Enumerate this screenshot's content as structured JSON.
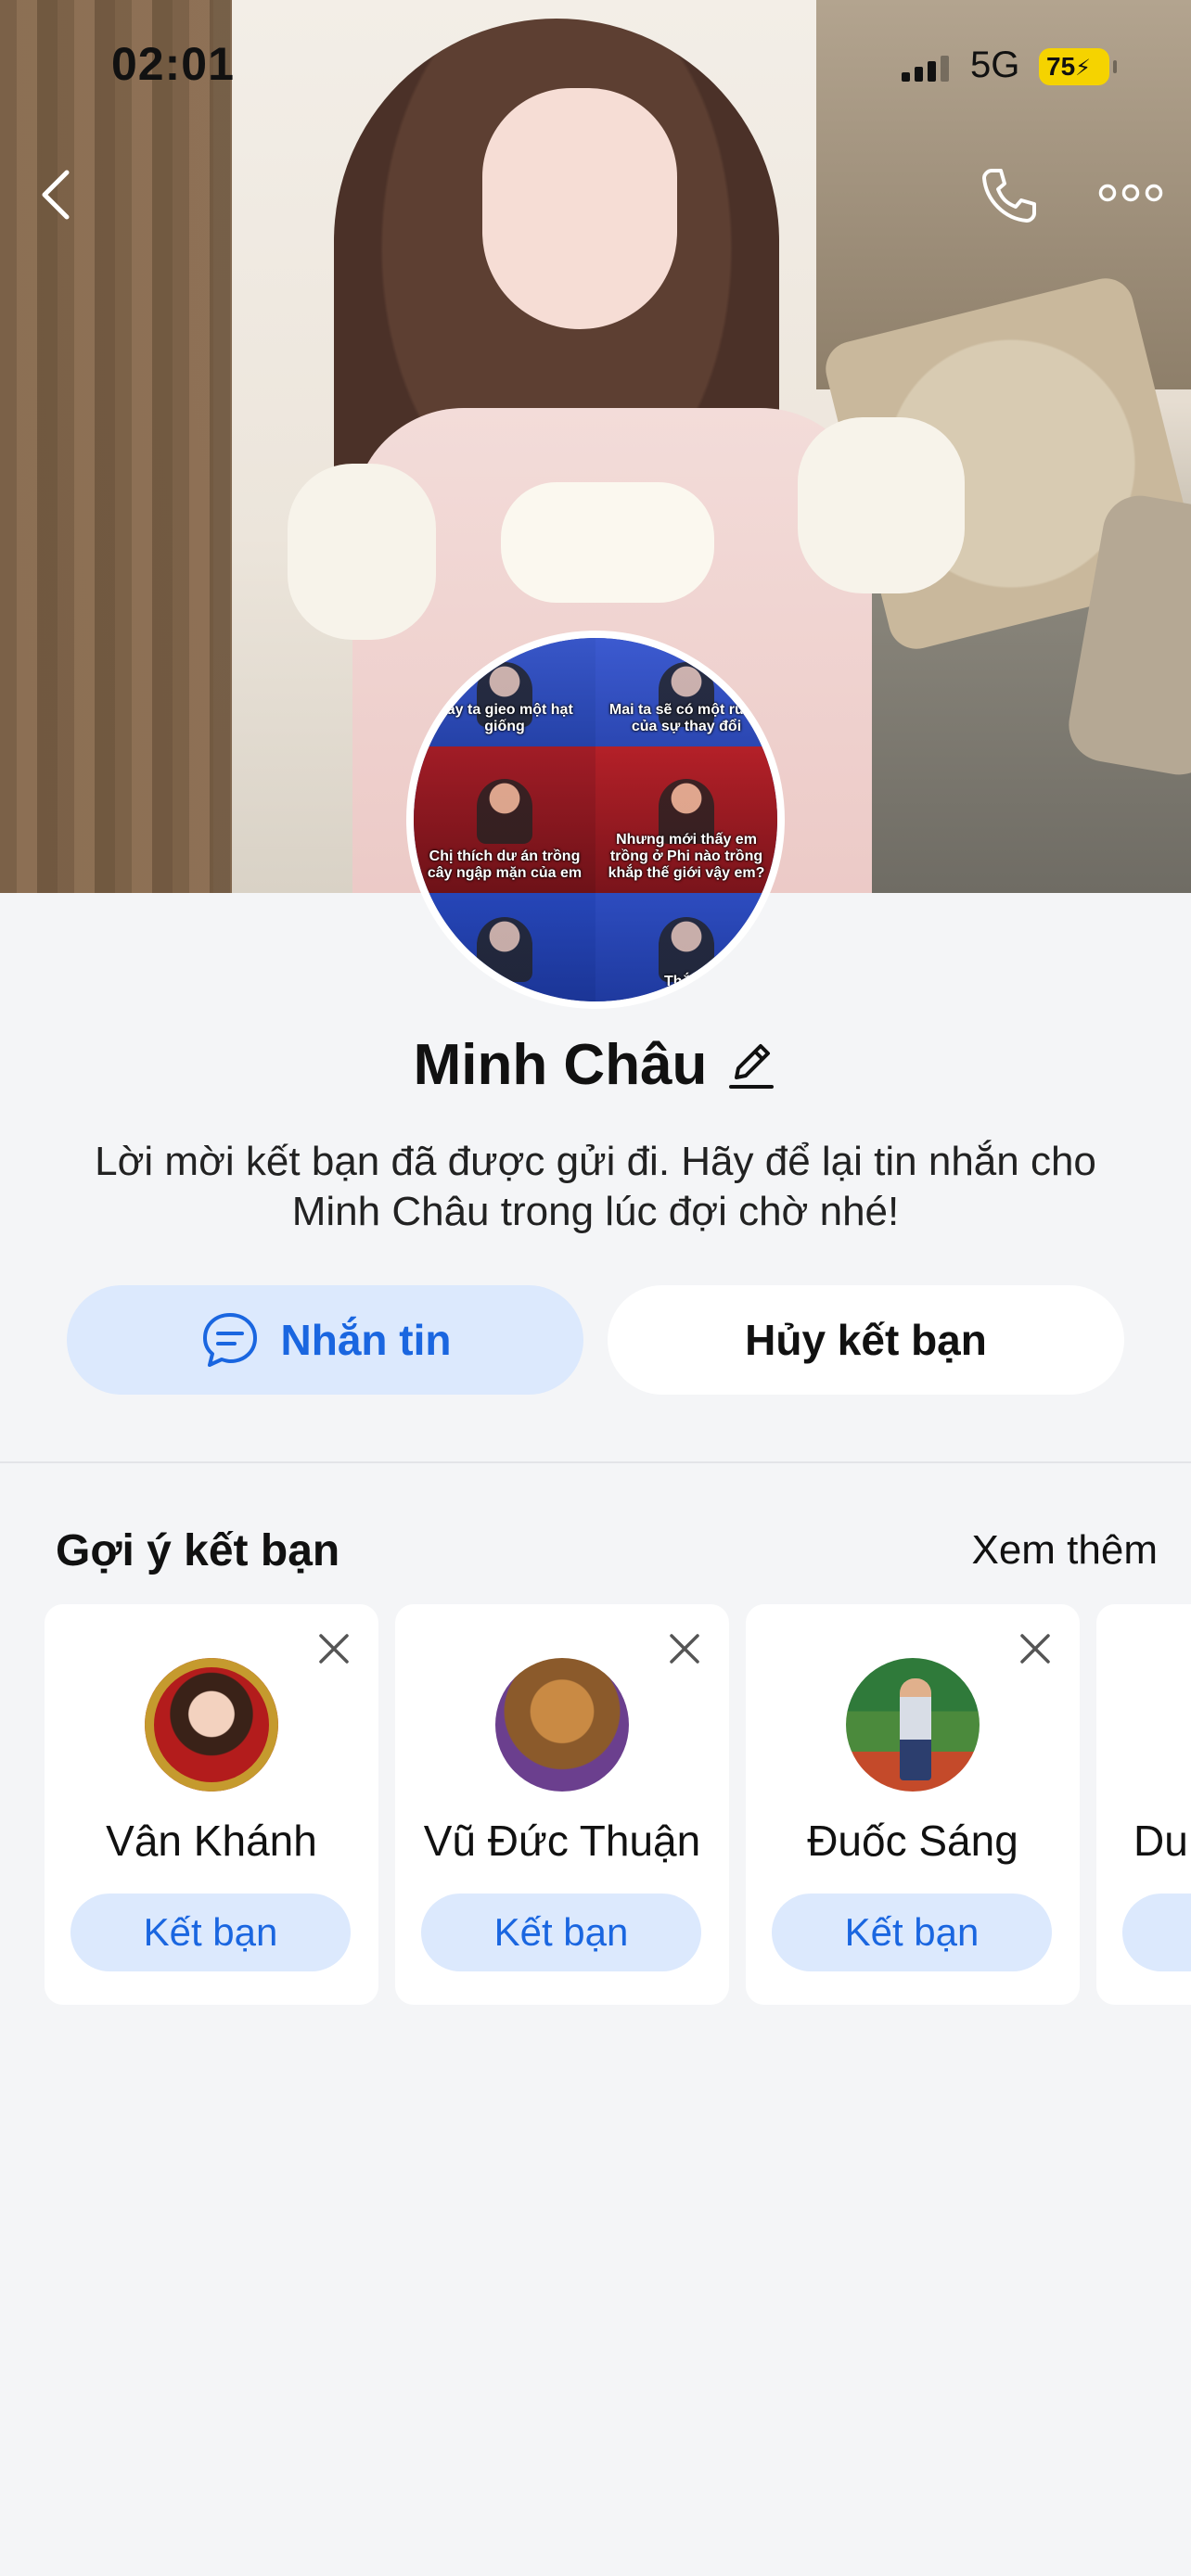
{
  "status_bar": {
    "time": "02:01",
    "network": "5G",
    "battery": "75"
  },
  "profile": {
    "name": "Minh Châu",
    "notice": "Lời mời kết bạn đã được gửi đi. Hãy để lại tin nhắn cho Minh Châu trong lúc đợi chờ nhé!",
    "avatar_captions": [
      "Nay ta gieo một hạt giống",
      "Mai ta sẽ có một rừng của sự thay đổi",
      "Chị thích dư án trồng cây ngập mặn của em",
      "Nhưng mới thấy em trồng ở Phi nào trồng khắp thế giới vậy em?",
      "",
      "Thắng"
    ]
  },
  "actions": {
    "message_label": "Nhắn tin",
    "unfriend_label": "Hủy kết bạn"
  },
  "suggestions": {
    "title": "Gợi ý kết bạn",
    "see_more": "Xem thêm",
    "items": [
      {
        "name": "Vân Khánh",
        "button": "Kết bạn"
      },
      {
        "name": "Vũ Đức Thuận",
        "button": "Kết bạn"
      },
      {
        "name": "Đuốc Sáng",
        "button": "Kết bạn"
      },
      {
        "name": "Du",
        "button": ""
      }
    ]
  },
  "colors": {
    "accent": "#1a66e0",
    "accent_bg": "#dce9fd",
    "page_bg": "#f4f5f7",
    "battery": "#f5d300"
  },
  "icons": [
    "back-icon",
    "phone-icon",
    "more-icon",
    "edit-icon",
    "chat-icon",
    "close-icon"
  ]
}
